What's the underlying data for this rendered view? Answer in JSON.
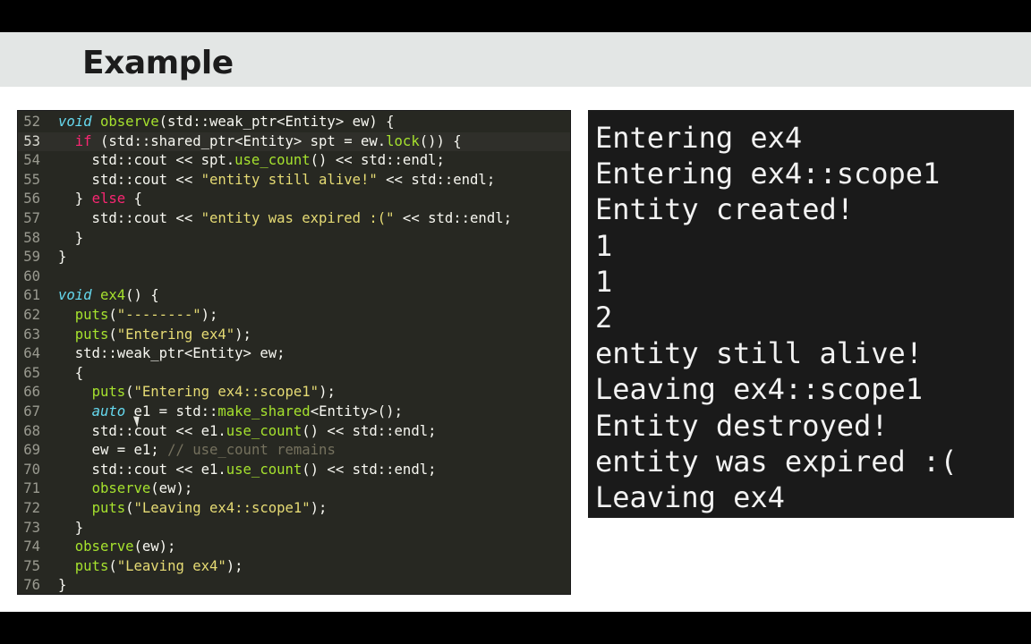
{
  "slide": {
    "title": "Example"
  },
  "editor": {
    "active_line": 53,
    "lines": [
      {
        "n": "52",
        "code": [
          [
            "void",
            "ty"
          ],
          [
            " "
          ],
          [
            "observe",
            "fn"
          ],
          [
            "(std::weak_ptr<Entity> ew) {"
          ]
        ]
      },
      {
        "n": "53",
        "code": [
          [
            "  "
          ],
          [
            "if",
            "kw"
          ],
          [
            " (std::shared_ptr<Entity> spt = ew."
          ],
          [
            "lock",
            "fn"
          ],
          [
            "()) {"
          ]
        ]
      },
      {
        "n": "54",
        "code": [
          [
            "    std::cout << spt."
          ],
          [
            "use_count",
            "fn"
          ],
          [
            "() << std::endl;"
          ]
        ]
      },
      {
        "n": "55",
        "code": [
          [
            "    std::cout << "
          ],
          [
            "\"entity still alive!\"",
            "st"
          ],
          [
            " << std::endl;"
          ]
        ]
      },
      {
        "n": "56",
        "code": [
          [
            "  } "
          ],
          [
            "else",
            "kw"
          ],
          [
            " {"
          ]
        ]
      },
      {
        "n": "57",
        "code": [
          [
            "    std::cout << "
          ],
          [
            "\"entity was expired :(\"",
            "st"
          ],
          [
            " << std::endl;"
          ]
        ]
      },
      {
        "n": "58",
        "code": [
          [
            "  }"
          ]
        ]
      },
      {
        "n": "59",
        "code": [
          [
            "}"
          ]
        ]
      },
      {
        "n": "60",
        "code": []
      },
      {
        "n": "61",
        "code": [
          [
            "void",
            "ty"
          ],
          [
            " "
          ],
          [
            "ex4",
            "fn"
          ],
          [
            "() {"
          ]
        ]
      },
      {
        "n": "62",
        "code": [
          [
            "  "
          ],
          [
            "puts",
            "fn"
          ],
          [
            "("
          ],
          [
            "\"--------\"",
            "st"
          ],
          [
            ");"
          ]
        ]
      },
      {
        "n": "63",
        "code": [
          [
            "  "
          ],
          [
            "puts",
            "fn"
          ],
          [
            "("
          ],
          [
            "\"Entering ex4\"",
            "st"
          ],
          [
            ");"
          ]
        ]
      },
      {
        "n": "64",
        "code": [
          [
            "  std::weak_ptr<Entity> ew;"
          ]
        ]
      },
      {
        "n": "65",
        "code": [
          [
            "  {"
          ]
        ]
      },
      {
        "n": "66",
        "code": [
          [
            "    "
          ],
          [
            "puts",
            "fn"
          ],
          [
            "("
          ],
          [
            "\"Entering ex4::scope1\"",
            "st"
          ],
          [
            ");"
          ]
        ]
      },
      {
        "n": "67",
        "code": [
          [
            "    "
          ],
          [
            "auto",
            "ty"
          ],
          [
            " e1 = std::"
          ],
          [
            "make_shared",
            "fn"
          ],
          [
            "<Entity>();"
          ]
        ]
      },
      {
        "n": "68",
        "code": [
          [
            "    std::cout << e1."
          ],
          [
            "use_count",
            "fn"
          ],
          [
            "() << std::endl;"
          ]
        ]
      },
      {
        "n": "69",
        "code": [
          [
            "    ew = e1; "
          ],
          [
            "// use_count remains",
            "cm"
          ]
        ]
      },
      {
        "n": "70",
        "code": [
          [
            "    std::cout << e1."
          ],
          [
            "use_count",
            "fn"
          ],
          [
            "() << std::endl;"
          ]
        ]
      },
      {
        "n": "71",
        "code": [
          [
            "    "
          ],
          [
            "observe",
            "fn"
          ],
          [
            "(ew);"
          ]
        ]
      },
      {
        "n": "72",
        "code": [
          [
            "    "
          ],
          [
            "puts",
            "fn"
          ],
          [
            "("
          ],
          [
            "\"Leaving ex4::scope1\"",
            "st"
          ],
          [
            ");"
          ]
        ]
      },
      {
        "n": "73",
        "code": [
          [
            "  }"
          ]
        ]
      },
      {
        "n": "74",
        "code": [
          [
            "  "
          ],
          [
            "observe",
            "fn"
          ],
          [
            "(ew);"
          ]
        ]
      },
      {
        "n": "75",
        "code": [
          [
            "  "
          ],
          [
            "puts",
            "fn"
          ],
          [
            "("
          ],
          [
            "\"Leaving ex4\"",
            "st"
          ],
          [
            ");"
          ]
        ]
      },
      {
        "n": "76",
        "code": [
          [
            "}"
          ]
        ]
      }
    ]
  },
  "console": {
    "lines": [
      "Entering ex4",
      "Entering ex4::scope1",
      "Entity created!",
      "1",
      "1",
      "2",
      "entity still alive!",
      "Leaving ex4::scope1",
      "Entity destroyed!",
      "entity was expired :(",
      "Leaving ex4"
    ]
  }
}
